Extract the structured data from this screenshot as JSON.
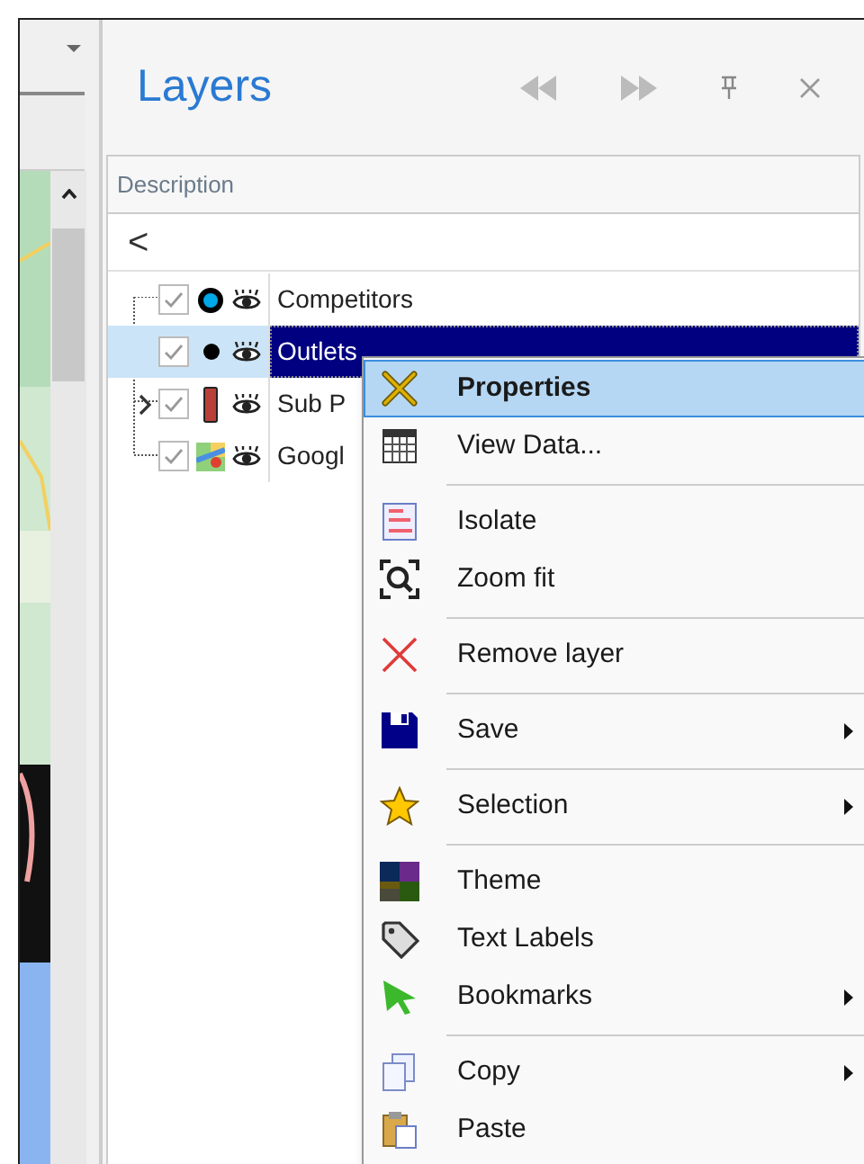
{
  "panel": {
    "title": "Layers"
  },
  "grid": {
    "header": "Description",
    "back": "<"
  },
  "layers": [
    {
      "name": "Competitors",
      "checked": true,
      "kind": "ring",
      "selected": false,
      "expandable": false
    },
    {
      "name": "Outlets",
      "checked": true,
      "kind": "dot",
      "selected": true,
      "expandable": false
    },
    {
      "name": "Sub P",
      "checked": true,
      "kind": "bar",
      "selected": false,
      "expandable": true
    },
    {
      "name": "Googl",
      "checked": true,
      "kind": "map",
      "selected": false,
      "expandable": false
    }
  ],
  "context_menu": [
    {
      "kind": "item",
      "label": "Properties",
      "selected": true,
      "submenu": false
    },
    {
      "kind": "item",
      "label": "View Data...",
      "selected": false,
      "submenu": false
    },
    {
      "kind": "separator"
    },
    {
      "kind": "item",
      "label": "Isolate",
      "selected": false,
      "submenu": false
    },
    {
      "kind": "item",
      "label": "Zoom fit",
      "selected": false,
      "submenu": false
    },
    {
      "kind": "separator"
    },
    {
      "kind": "item",
      "label": "Remove layer",
      "selected": false,
      "submenu": false
    },
    {
      "kind": "separator"
    },
    {
      "kind": "item",
      "label": "Save",
      "selected": false,
      "submenu": true
    },
    {
      "kind": "separator"
    },
    {
      "kind": "item",
      "label": "Selection",
      "selected": false,
      "submenu": true
    },
    {
      "kind": "separator"
    },
    {
      "kind": "item",
      "label": "Theme",
      "selected": false,
      "submenu": false
    },
    {
      "kind": "item",
      "label": "Text Labels",
      "selected": false,
      "submenu": false
    },
    {
      "kind": "item",
      "label": "Bookmarks",
      "selected": false,
      "submenu": true
    },
    {
      "kind": "separator"
    },
    {
      "kind": "item",
      "label": "Copy",
      "selected": false,
      "submenu": true
    },
    {
      "kind": "item",
      "label": "Paste",
      "selected": false,
      "submenu": false
    }
  ]
}
